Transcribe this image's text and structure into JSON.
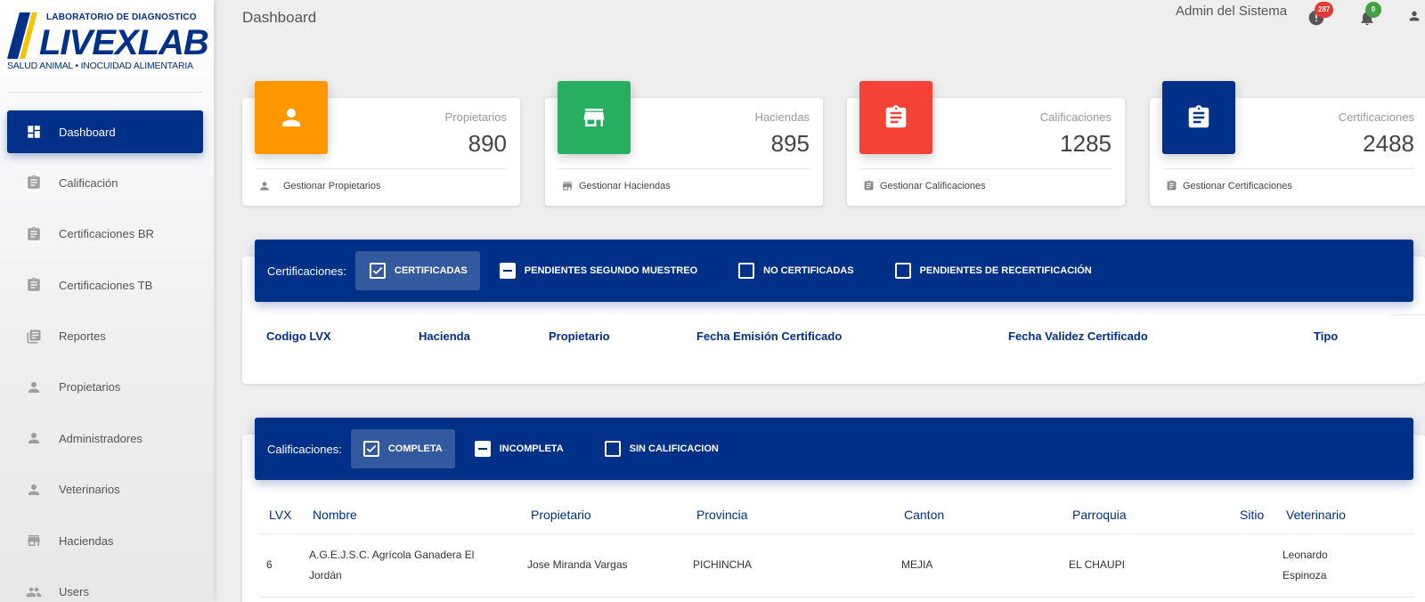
{
  "brand": {
    "top_line": "LABORATORIO DE DIAGNOSTICO",
    "name": "LIVEXLAB",
    "tagline": "SALUD ANIMAL • INOCUIDAD ALIMENTARIA",
    "color": "#003087"
  },
  "sidebar": {
    "items": [
      {
        "label": "Dashboard",
        "icon": "dashboard-icon",
        "active": true
      },
      {
        "label": "Calificación",
        "icon": "clipboard-icon"
      },
      {
        "label": "Certificaciones BR",
        "icon": "clipboard-icon"
      },
      {
        "label": "Certificaciones TB",
        "icon": "clipboard-icon"
      },
      {
        "label": "Reportes",
        "icon": "library-books-icon"
      },
      {
        "label": "Propietarios",
        "icon": "person-icon"
      },
      {
        "label": "Administradores",
        "icon": "person-icon"
      },
      {
        "label": "Veterinarios",
        "icon": "person-icon"
      },
      {
        "label": "Haciendas",
        "icon": "store-icon"
      },
      {
        "label": "Users",
        "icon": "people-icon"
      }
    ]
  },
  "header": {
    "title": "Dashboard",
    "user": "Admin del Sistema",
    "alerts_badge": "287",
    "notifications_badge": "0",
    "alerts_color": "#e53935",
    "notifications_color": "#43a047"
  },
  "stats": [
    {
      "label": "Propietarios",
      "value": "890",
      "link": "Gestionar Propietarios",
      "color": "#ff9800",
      "icon": "person-icon"
    },
    {
      "label": "Haciendas",
      "value": "895",
      "link": "Gestionar Haciendas",
      "color": "#27ae60",
      "icon": "store-icon"
    },
    {
      "label": "Calificaciones",
      "value": "1285",
      "link": "Gestionar Calificaciones",
      "color": "#f44336",
      "icon": "clipboard-icon"
    },
    {
      "label": "Certificaciones",
      "value": "2488",
      "link": "Gestionar Certificaciones",
      "color": "#003087",
      "icon": "clipboard-icon"
    }
  ],
  "certificaciones": {
    "label": "Certificaciones:",
    "filters": [
      {
        "label": "CERTIFICADAS",
        "state": "checked"
      },
      {
        "label": "PENDIENTES SEGUNDO MUESTREO",
        "state": "indeterminate"
      },
      {
        "label": "NO CERTIFICADAS",
        "state": "unchecked"
      },
      {
        "label": "PENDIENTES DE RECERTIFICACIÓN",
        "state": "unchecked"
      }
    ],
    "columns": [
      "Codigo LVX",
      "Hacienda",
      "Propietario",
      "Fecha Emisión Certificado",
      "Fecha Validez Certificado",
      "Tipo"
    ]
  },
  "calificaciones": {
    "label": "Calificaciones:",
    "filters": [
      {
        "label": "COMPLETA",
        "state": "checked"
      },
      {
        "label": "INCOMPLETA",
        "state": "indeterminate"
      },
      {
        "label": "SIN CALIFICACION",
        "state": "unchecked"
      }
    ],
    "columns": [
      "LVX",
      "Nombre",
      "Propietario",
      "Provincia",
      "Canton",
      "Parroquia",
      "Sitio",
      "Veterinario"
    ],
    "rows": [
      {
        "lvx": "6",
        "nombre": "A.G.E.J.S.C. Agrícola Ganadera El Jordán",
        "propietario": "Jose Miranda Vargas",
        "provincia": "PICHINCHA",
        "canton": "MEJIA",
        "parroquia": "EL CHAUPI",
        "sitio": "",
        "veterinario": "Leonardo Espinoza"
      }
    ]
  }
}
